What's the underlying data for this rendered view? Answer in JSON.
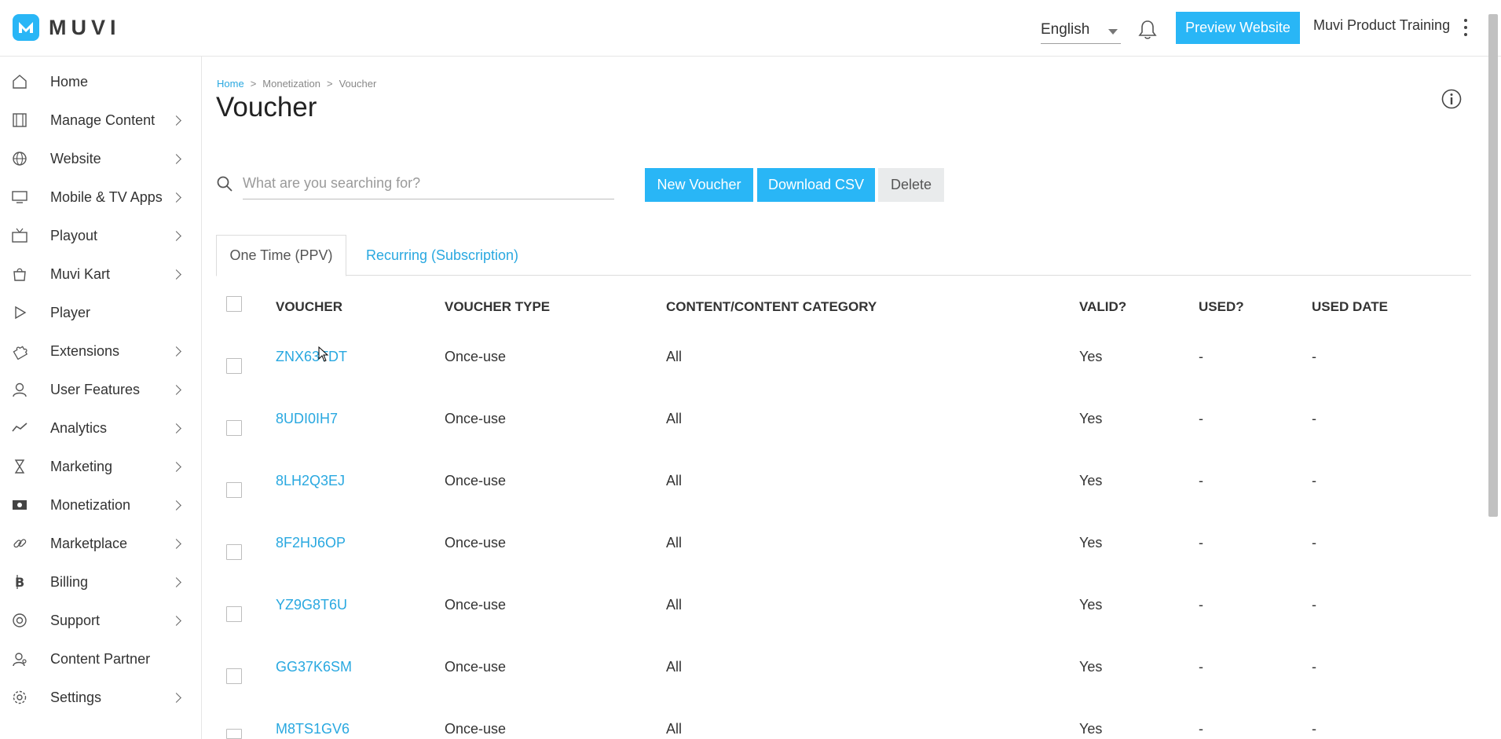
{
  "brand": {
    "logo_text": "MUVI",
    "accent": "#29b6f6",
    "link": "#29a8e0"
  },
  "header": {
    "language": "English",
    "preview_button": "Preview Website",
    "account_name": "Muvi Product Training"
  },
  "sidebar": {
    "items": [
      {
        "label": "Home",
        "icon": "home-icon",
        "has_submenu": false
      },
      {
        "label": "Manage Content",
        "icon": "film-icon",
        "has_submenu": true
      },
      {
        "label": "Website",
        "icon": "globe-icon",
        "has_submenu": true
      },
      {
        "label": "Mobile & TV Apps",
        "icon": "monitor-icon",
        "has_submenu": true
      },
      {
        "label": "Playout",
        "icon": "tv-icon",
        "has_submenu": true
      },
      {
        "label": "Muvi Kart",
        "icon": "shopping-bag-icon",
        "has_submenu": true
      },
      {
        "label": "Player",
        "icon": "play-icon",
        "has_submenu": false
      },
      {
        "label": "Extensions",
        "icon": "puzzle-icon",
        "has_submenu": true
      },
      {
        "label": "User Features",
        "icon": "user-icon",
        "has_submenu": true
      },
      {
        "label": "Analytics",
        "icon": "trend-icon",
        "has_submenu": true
      },
      {
        "label": "Marketing",
        "icon": "hourglass-icon",
        "has_submenu": true
      },
      {
        "label": "Monetization",
        "icon": "money-icon",
        "has_submenu": true
      },
      {
        "label": "Marketplace",
        "icon": "link-icon",
        "has_submenu": true
      },
      {
        "label": "Billing",
        "icon": "bitcoin-icon",
        "has_submenu": true
      },
      {
        "label": "Support",
        "icon": "lifebuoy-icon",
        "has_submenu": true
      },
      {
        "label": "Content Partner",
        "icon": "partner-icon",
        "has_submenu": false
      },
      {
        "label": "Settings",
        "icon": "gear-icon",
        "has_submenu": true
      }
    ]
  },
  "breadcrumb": {
    "home": "Home",
    "sep": ">",
    "section": "Monetization",
    "current": "Voucher"
  },
  "page": {
    "title": "Voucher"
  },
  "search": {
    "placeholder": "What are you searching for?"
  },
  "toolbar": {
    "new_label": "New Voucher",
    "csv_label": "Download CSV",
    "delete_label": "Delete"
  },
  "tabs": {
    "active": "One Time (PPV)",
    "inactive": "Recurring (Subscription)"
  },
  "table": {
    "headers": {
      "voucher": "VOUCHER",
      "type": "VOUCHER TYPE",
      "content": "CONTENT/CONTENT CATEGORY",
      "valid": "VALID?",
      "used": "USED?",
      "used_date": "USED DATE"
    },
    "rows": [
      {
        "voucher": "ZNX63TDT",
        "type": "Once-use",
        "content": "All",
        "valid": "Yes",
        "used": "-",
        "used_date": "-"
      },
      {
        "voucher": "8UDI0IH7",
        "type": "Once-use",
        "content": "All",
        "valid": "Yes",
        "used": "-",
        "used_date": "-"
      },
      {
        "voucher": "8LH2Q3EJ",
        "type": "Once-use",
        "content": "All",
        "valid": "Yes",
        "used": "-",
        "used_date": "-"
      },
      {
        "voucher": "8F2HJ6OP",
        "type": "Once-use",
        "content": "All",
        "valid": "Yes",
        "used": "-",
        "used_date": "-"
      },
      {
        "voucher": "YZ9G8T6U",
        "type": "Once-use",
        "content": "All",
        "valid": "Yes",
        "used": "-",
        "used_date": "-"
      },
      {
        "voucher": "GG37K6SM",
        "type": "Once-use",
        "content": "All",
        "valid": "Yes",
        "used": "-",
        "used_date": "-"
      },
      {
        "voucher": "M8TS1GV6",
        "type": "Once-use",
        "content": "All",
        "valid": "Yes",
        "used": "-",
        "used_date": "-"
      }
    ]
  }
}
